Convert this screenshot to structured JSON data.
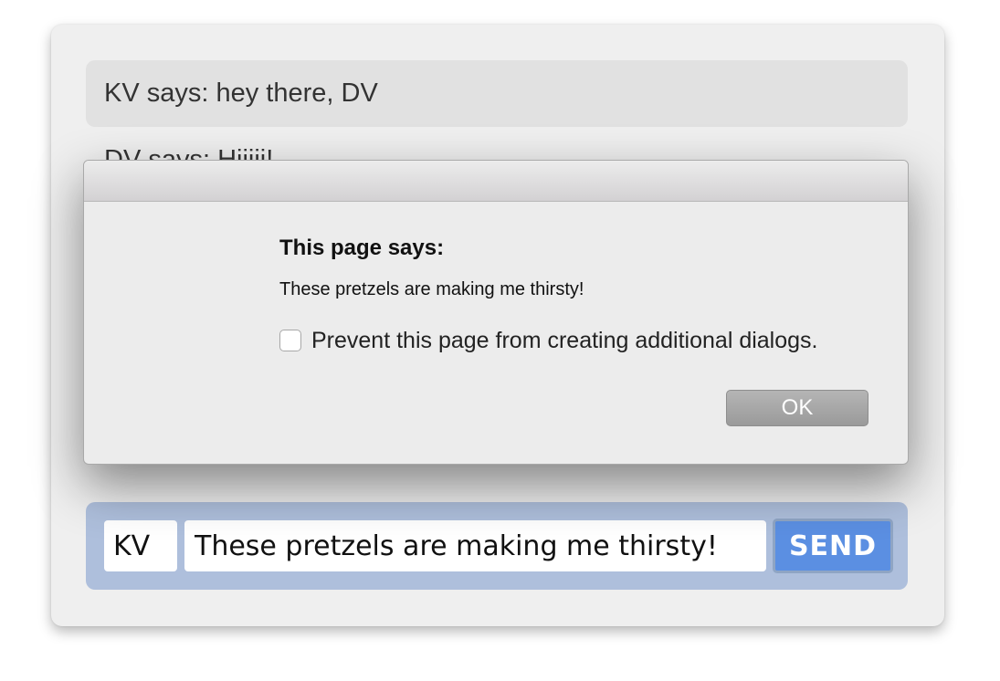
{
  "chat": {
    "messages": [
      {
        "text": "KV says: hey there, DV"
      },
      {
        "text": "DV says: Hiiiii!"
      }
    ]
  },
  "composer": {
    "name_value": "KV",
    "message_value": "These pretzels are making me thirsty!",
    "send_label": "SEND",
    "colors": {
      "panel": "#aebfdc",
      "send_button": "#5b8fe2"
    }
  },
  "dialog": {
    "heading": "This page says:",
    "message": "These pretzels are making me thirsty!",
    "prevent_label": "Prevent this page from creating additional dialogs.",
    "prevent_checked": false,
    "ok_label": "OK"
  }
}
